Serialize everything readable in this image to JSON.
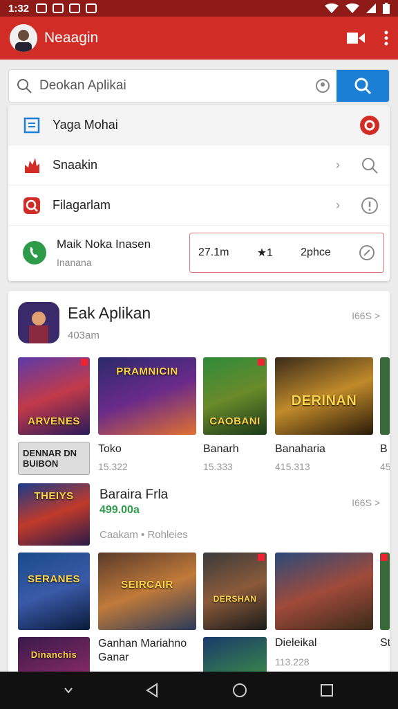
{
  "status_bar": {
    "time": "1:32"
  },
  "app_bar": {
    "title": "Neaagin"
  },
  "search": {
    "placeholder": "Deokan Aplikai"
  },
  "menu": {
    "items": [
      {
        "label": "Yaga Mohai"
      },
      {
        "label": "Snaakin"
      },
      {
        "label": "Filagarlam"
      }
    ],
    "last": {
      "label": "Maik Noka Inasen",
      "sub": "Inanana"
    },
    "callout": {
      "left": "27.1m",
      "star": "★1",
      "right": "2phce"
    }
  },
  "section": {
    "title": "Eak Aplikan",
    "subtitle": "403am",
    "more": "I66S >",
    "games_row1": [
      {
        "caption": "ARVENES",
        "name": "Toko",
        "value": "15.322"
      },
      {
        "caption": "PRAMNICIN",
        "name": "",
        "value": ""
      },
      {
        "caption": "CAOBANI",
        "name": "Banarh",
        "value": "15.333"
      },
      {
        "caption": "DERINAN",
        "name": "Banaharia",
        "value": "415.313"
      },
      {
        "caption": "",
        "name": "B",
        "value": "45"
      }
    ],
    "side_banner": "DENNAR DN BUIBON",
    "featured": {
      "caption": "THEIYS",
      "name": "Baraira Frla",
      "price": "499.00a",
      "tags": "Caakam • Rohleies",
      "more": "I66S >"
    },
    "games_row2": [
      {
        "caption": "SERANES",
        "name": ""
      },
      {
        "caption": "SEIRCAIR",
        "name": ""
      },
      {
        "caption": "DERSHAN",
        "name": ""
      },
      {
        "caption": "",
        "name": ""
      },
      {
        "caption": "",
        "name": ""
      }
    ],
    "games_row3": [
      {
        "caption": "Dinanchis",
        "name": "",
        "value": ""
      },
      {
        "caption": "",
        "name": "Ganhan Mariahno Ganar",
        "value": ""
      },
      {
        "caption": "",
        "name": "Dieleikal",
        "value": "113.228"
      },
      {
        "caption": "",
        "name": "St",
        "value": ""
      }
    ]
  },
  "colors": {
    "appbar": "#d12c25",
    "status": "#8e1b17",
    "search_button": "#1b7fd6",
    "price": "#2e9b4a"
  }
}
